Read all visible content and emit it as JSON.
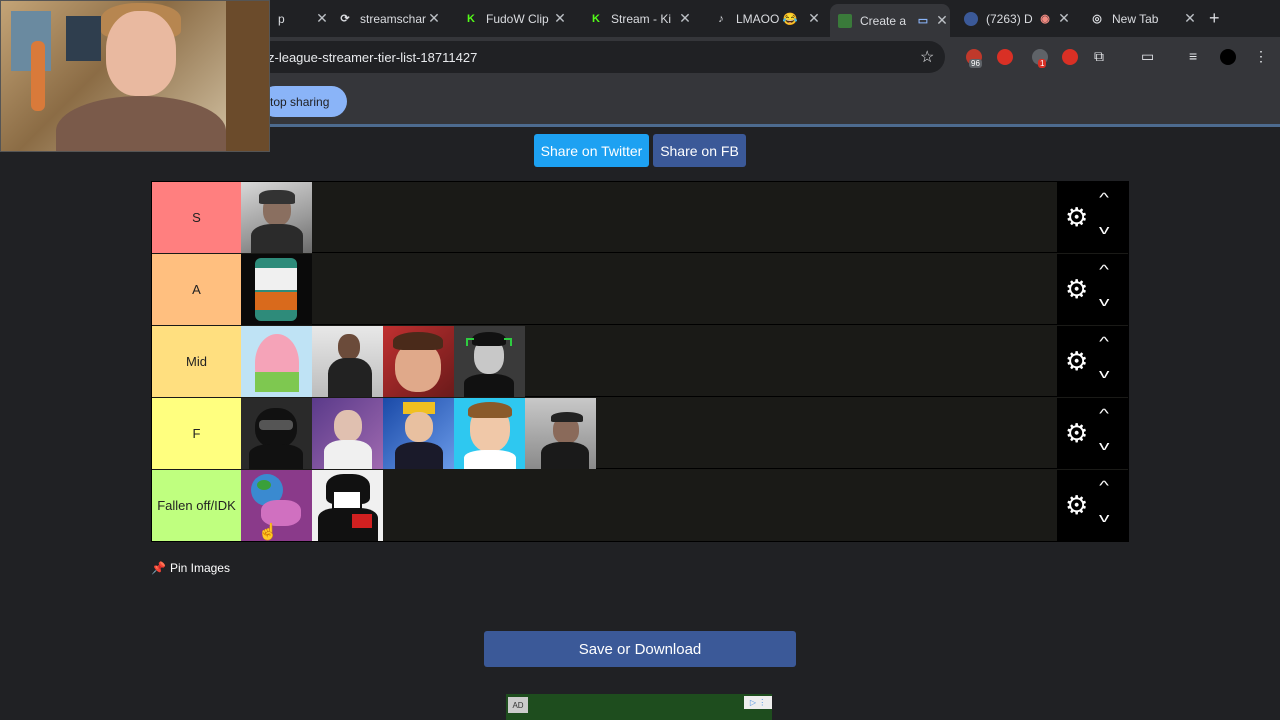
{
  "browser": {
    "tabs": [
      {
        "title": "p",
        "favicon": "tab-icon",
        "active": false
      },
      {
        "title": "streamschar",
        "favicon": "streamschar-icon",
        "active": false
      },
      {
        "title": "FudoW Clip",
        "favicon": "kick-icon",
        "active": false
      },
      {
        "title": "Stream - Ki",
        "favicon": "kick-icon",
        "active": false
      },
      {
        "title": "LMAOO 😂",
        "favicon": "tiktok-icon",
        "active": false
      },
      {
        "title": "Create a",
        "favicon": "tiermaker-icon",
        "active": true
      },
      {
        "title": "(7263) D",
        "favicon": "badge-icon",
        "active": false
      },
      {
        "title": "New Tab",
        "favicon": "chrome-icon",
        "active": false
      }
    ],
    "url": "z-league-streamer-tier-list-18711427",
    "extension_badge_1": "96",
    "extension_badge_2": "1",
    "stop_sharing_label": "top sharing"
  },
  "share": {
    "twitter_label": "Share on Twitter",
    "fb_label": "Share on FB"
  },
  "tiers": [
    {
      "label": "S",
      "color": "#ff7f7f",
      "item_count": 1
    },
    {
      "label": "A",
      "color": "#ffbf7f",
      "item_count": 1
    },
    {
      "label": "Mid",
      "color": "#ffdf7f",
      "item_count": 4
    },
    {
      "label": "F",
      "color": "#ffff7f",
      "item_count": 5
    },
    {
      "label": "Fallen off/IDK",
      "color": "#bfff7f",
      "item_count": 2
    }
  ],
  "pin_images_label": "Pin Images",
  "save_label": "Save or Download",
  "ad_label": "AD",
  "colors": {
    "twitter": "#1da1f2",
    "facebook": "#3b5998",
    "background": "#202124"
  }
}
